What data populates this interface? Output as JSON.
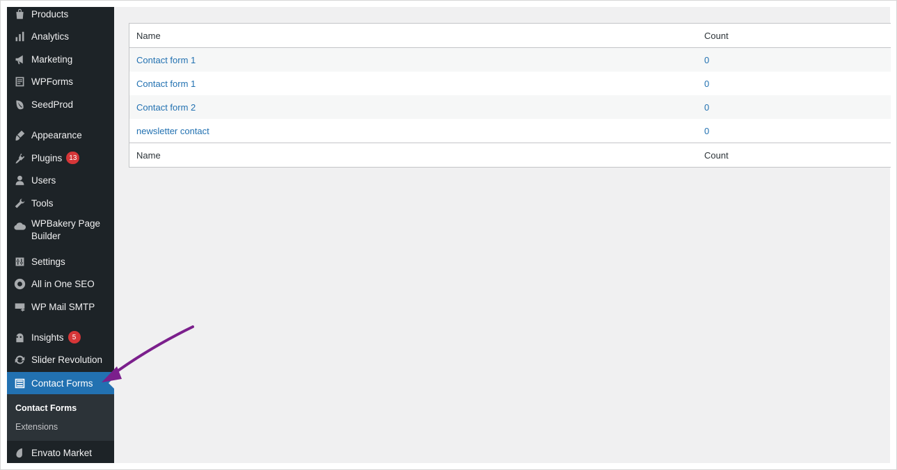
{
  "sidebar": {
    "items": [
      {
        "label": "Products",
        "icon": "bag-icon"
      },
      {
        "label": "Analytics",
        "icon": "bar-chart-icon"
      },
      {
        "label": "Marketing",
        "icon": "megaphone-icon"
      },
      {
        "label": "WPForms",
        "icon": "form-icon"
      },
      {
        "label": "SeedProd",
        "icon": "leaf-icon"
      },
      {
        "label": "Appearance",
        "icon": "paintbrush-icon"
      },
      {
        "label": "Plugins",
        "icon": "plug-icon",
        "badge": "13"
      },
      {
        "label": "Users",
        "icon": "user-icon"
      },
      {
        "label": "Tools",
        "icon": "wrench-icon"
      },
      {
        "label": "WPBakery Page Builder",
        "icon": "cloud-icon"
      },
      {
        "label": "Settings",
        "icon": "sliders-icon"
      },
      {
        "label": "All in One SEO",
        "icon": "gear-icon"
      },
      {
        "label": "WP Mail SMTP",
        "icon": "mail-icon"
      },
      {
        "label": "Insights",
        "icon": "monster-icon",
        "badge": "5"
      },
      {
        "label": "Slider Revolution",
        "icon": "refresh-icon"
      },
      {
        "label": "Contact Forms",
        "icon": "list-icon"
      },
      {
        "label": "Envato Market",
        "icon": "drop-icon"
      }
    ],
    "submenu": [
      {
        "label": "Contact Forms"
      },
      {
        "label": "Extensions"
      }
    ]
  },
  "table": {
    "columns": [
      "Name",
      "Count"
    ],
    "rows": [
      {
        "name": "Contact form 1",
        "count": "0"
      },
      {
        "name": "Contact form 1",
        "count": "0"
      },
      {
        "name": "Contact form 2",
        "count": "0"
      },
      {
        "name": "newsletter contact",
        "count": "0"
      }
    ],
    "footer": [
      "Name",
      "Count"
    ]
  },
  "colors": {
    "sidebar_bg": "#1d2327",
    "active_bg": "#2271b1",
    "link": "#2271b1",
    "badge": "#d63638",
    "annotation_arrow": "#7b1f8c"
  }
}
